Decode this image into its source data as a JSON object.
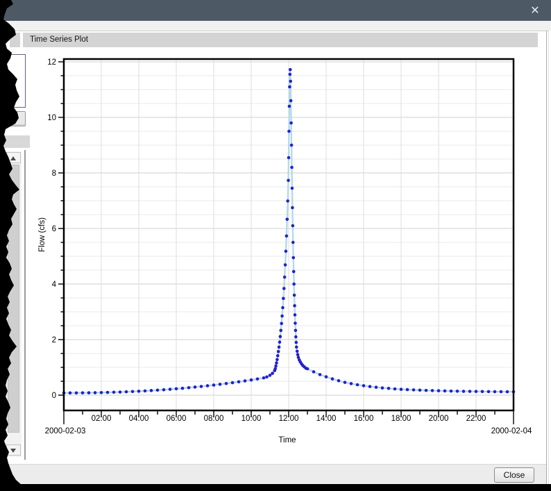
{
  "window": {
    "close_icon": "✕"
  },
  "panel": {
    "header_title": "Time Series Plot"
  },
  "footer": {
    "close_button": "Close"
  },
  "colors": {
    "titlebar": "#4d5a66",
    "header_bg": "#d4d4d4",
    "line": "#b5d9ea",
    "point": "#2121cd",
    "grid_minor": "#e9e9e9",
    "grid_major": "#cfcfcf",
    "axis": "#000000"
  },
  "chart_data": {
    "type": "line",
    "title": "Time Series Plot",
    "xlabel": "Time",
    "ylabel": "Flow (cfs)",
    "x_date_start": "2000-02-03",
    "x_date_end": "2000-02-04",
    "xlim_hours": [
      0,
      24
    ],
    "ylim": [
      -0.55,
      12.1
    ],
    "y_ticks": [
      0,
      2,
      4,
      6,
      8,
      10,
      12
    ],
    "y_minor_step": 0.5,
    "x_minor_step_hours": 1,
    "x_ticks": [
      {
        "hour": 2,
        "label": "02:00"
      },
      {
        "hour": 4,
        "label": "04:00"
      },
      {
        "hour": 6,
        "label": "06:00"
      },
      {
        "hour": 8,
        "label": "08:00"
      },
      {
        "hour": 10,
        "label": "10:00"
      },
      {
        "hour": 12,
        "label": "12:00"
      },
      {
        "hour": 14,
        "label": "14:00"
      },
      {
        "hour": 16,
        "label": "16:00"
      },
      {
        "hour": 18,
        "label": "18:00"
      },
      {
        "hour": 20,
        "label": "20:00"
      },
      {
        "hour": 22,
        "label": "22:00"
      }
    ],
    "grid": true,
    "legend": false,
    "series": [
      {
        "name": "Flow",
        "peak_value_cfs": 11.72,
        "peak_time": "12:05",
        "points": [
          [
            0,
            0.08
          ],
          [
            0.333,
            0.08
          ],
          [
            0.667,
            0.081
          ],
          [
            1,
            0.083
          ],
          [
            1.333,
            0.085
          ],
          [
            1.667,
            0.089
          ],
          [
            2,
            0.093
          ],
          [
            2.333,
            0.099
          ],
          [
            2.667,
            0.105
          ],
          [
            3,
            0.112
          ],
          [
            3.333,
            0.121
          ],
          [
            3.667,
            0.131
          ],
          [
            4,
            0.141
          ],
          [
            4.333,
            0.153
          ],
          [
            4.667,
            0.166
          ],
          [
            5,
            0.18
          ],
          [
            5.333,
            0.195
          ],
          [
            5.667,
            0.212
          ],
          [
            6,
            0.23
          ],
          [
            6.333,
            0.248
          ],
          [
            6.667,
            0.269
          ],
          [
            7,
            0.291
          ],
          [
            7.333,
            0.313
          ],
          [
            7.667,
            0.338
          ],
          [
            8,
            0.363
          ],
          [
            8.333,
            0.391
          ],
          [
            8.667,
            0.419
          ],
          [
            9,
            0.449
          ],
          [
            9.333,
            0.48
          ],
          [
            9.667,
            0.513
          ],
          [
            10,
            0.548
          ],
          [
            10.333,
            0.584
          ],
          [
            10.667,
            0.621
          ],
          [
            10.833,
            0.655
          ],
          [
            11,
            0.715
          ],
          [
            11.133,
            0.785
          ],
          [
            11.25,
            0.885
          ],
          [
            11.283,
            0.95
          ],
          [
            11.317,
            1.05
          ],
          [
            11.35,
            1.16
          ],
          [
            11.383,
            1.28
          ],
          [
            11.417,
            1.42
          ],
          [
            11.45,
            1.57
          ],
          [
            11.483,
            1.73
          ],
          [
            11.517,
            1.91
          ],
          [
            11.55,
            2.11
          ],
          [
            11.583,
            2.33
          ],
          [
            11.617,
            2.58
          ],
          [
            11.65,
            2.85
          ],
          [
            11.683,
            3.15
          ],
          [
            11.717,
            3.48
          ],
          [
            11.75,
            3.84
          ],
          [
            11.783,
            4.25
          ],
          [
            11.817,
            4.69
          ],
          [
            11.85,
            5.18
          ],
          [
            11.883,
            5.73
          ],
          [
            11.917,
            6.33
          ],
          [
            11.95,
            6.99
          ],
          [
            11.983,
            7.73
          ],
          [
            12,
            8.55
          ],
          [
            12.017,
            9.5
          ],
          [
            12.033,
            10.4
          ],
          [
            12.05,
            11.1
          ],
          [
            12.067,
            11.55
          ],
          [
            12.083,
            11.72
          ],
          [
            12.1,
            11.3
          ],
          [
            12.117,
            10.6
          ],
          [
            12.133,
            9.8
          ],
          [
            12.15,
            9.0
          ],
          [
            12.167,
            8.2
          ],
          [
            12.183,
            7.45
          ],
          [
            12.2,
            6.75
          ],
          [
            12.217,
            6.1
          ],
          [
            12.233,
            5.5
          ],
          [
            12.25,
            4.95
          ],
          [
            12.267,
            4.45
          ],
          [
            12.283,
            4.0
          ],
          [
            12.3,
            3.6
          ],
          [
            12.317,
            3.22
          ],
          [
            12.333,
            2.89
          ],
          [
            12.35,
            2.59
          ],
          [
            12.367,
            2.33
          ],
          [
            12.383,
            2.1
          ],
          [
            12.4,
            1.9
          ],
          [
            12.417,
            1.73
          ],
          [
            12.45,
            1.58
          ],
          [
            12.483,
            1.46
          ],
          [
            12.517,
            1.36
          ],
          [
            12.567,
            1.27
          ],
          [
            12.617,
            1.2
          ],
          [
            12.683,
            1.13
          ],
          [
            12.75,
            1.07
          ],
          [
            12.833,
            1.02
          ],
          [
            12.917,
            0.97
          ],
          [
            13,
            0.95
          ],
          [
            13.333,
            0.84
          ],
          [
            13.667,
            0.74
          ],
          [
            14,
            0.66
          ],
          [
            14.333,
            0.585
          ],
          [
            14.667,
            0.52
          ],
          [
            15,
            0.46
          ],
          [
            15.333,
            0.415
          ],
          [
            15.667,
            0.375
          ],
          [
            16,
            0.34
          ],
          [
            16.333,
            0.31
          ],
          [
            16.667,
            0.285
          ],
          [
            17,
            0.26
          ],
          [
            17.333,
            0.245
          ],
          [
            17.667,
            0.225
          ],
          [
            18,
            0.21
          ],
          [
            18.333,
            0.2
          ],
          [
            18.667,
            0.19
          ],
          [
            19,
            0.18
          ],
          [
            19.333,
            0.172
          ],
          [
            19.667,
            0.165
          ],
          [
            20,
            0.158
          ],
          [
            20.333,
            0.152
          ],
          [
            20.667,
            0.147
          ],
          [
            21,
            0.143
          ],
          [
            21.333,
            0.139
          ],
          [
            21.667,
            0.136
          ],
          [
            22,
            0.133
          ],
          [
            22.333,
            0.13
          ],
          [
            22.667,
            0.128
          ],
          [
            23,
            0.126
          ],
          [
            23.333,
            0.124
          ],
          [
            23.667,
            0.123
          ],
          [
            24,
            0.122
          ]
        ]
      }
    ]
  }
}
